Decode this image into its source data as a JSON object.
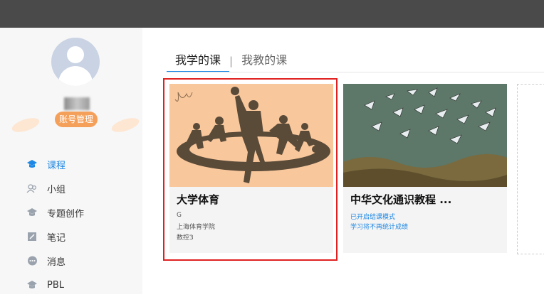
{
  "sidebar": {
    "account_button": "账号管理",
    "items": [
      {
        "label": "课程",
        "icon": "graduation-cap-icon",
        "active": true
      },
      {
        "label": "小组",
        "icon": "group-icon",
        "active": false
      },
      {
        "label": "专题创作",
        "icon": "creation-icon",
        "active": false
      },
      {
        "label": "笔记",
        "icon": "note-icon",
        "active": false
      },
      {
        "label": "消息",
        "icon": "message-icon",
        "active": false
      },
      {
        "label": "PBL",
        "icon": "pbl-icon",
        "active": false
      }
    ]
  },
  "tabs": {
    "learning": "我学的课",
    "separator": "|",
    "teaching": "我教的课"
  },
  "courses": [
    {
      "title": "大学体育",
      "teacher": "G",
      "school": "上海体育学院",
      "class": "数控3"
    },
    {
      "title": "中华文化通识教程 ...",
      "note1": "已开启结课模式",
      "note2": "学习将不再统计成绩"
    }
  ],
  "colors": {
    "accent": "#1e88e5",
    "account_button": "#f5a05a",
    "highlight_border": "#e02020",
    "topbar": "#4a4a4a"
  }
}
